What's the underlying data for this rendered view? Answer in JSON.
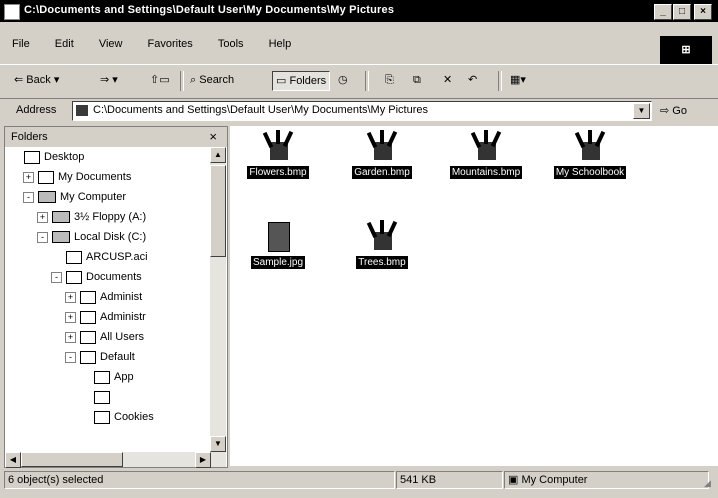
{
  "window": {
    "title": "C:\\Documents and Settings\\Default User\\My Documents\\My Pictures",
    "controls": [
      "_",
      "□",
      "×"
    ]
  },
  "menu": [
    "File",
    "Edit",
    "View",
    "Favorites",
    "Tools",
    "Help"
  ],
  "toolbar": {
    "back": "Back",
    "search": "Search",
    "folders": "Folders"
  },
  "address": {
    "label": "Address",
    "value": "C:\\Documents and Settings\\Default User\\My Documents\\My Pictures",
    "go": "Go"
  },
  "folders_pane": {
    "title": "Folders",
    "close": "×",
    "tree": [
      {
        "label": "Desktop",
        "depth": 0,
        "expander": "",
        "kind": "desktop"
      },
      {
        "label": "My Documents",
        "depth": 1,
        "expander": "+",
        "kind": "folder"
      },
      {
        "label": "My Computer",
        "depth": 1,
        "expander": "-",
        "kind": "computer"
      },
      {
        "label": "3½ Floppy (A:)",
        "depth": 2,
        "expander": "+",
        "kind": "drive"
      },
      {
        "label": "Local Disk (C:)",
        "depth": 2,
        "expander": "-",
        "kind": "drive"
      },
      {
        "label": "ARCUSP.aci",
        "depth": 3,
        "expander": "",
        "kind": "folder"
      },
      {
        "label": "Documents",
        "depth": 3,
        "expander": "-",
        "kind": "folder"
      },
      {
        "label": "Administ",
        "depth": 4,
        "expander": "+",
        "kind": "folder"
      },
      {
        "label": "Administr",
        "depth": 4,
        "expander": "+",
        "kind": "folder"
      },
      {
        "label": "All Users",
        "depth": 4,
        "expander": "+",
        "kind": "folder"
      },
      {
        "label": "Default",
        "depth": 4,
        "expander": "-",
        "kind": "folder"
      },
      {
        "label": "App",
        "depth": 5,
        "expander": "",
        "kind": "folder"
      },
      {
        "label": "",
        "depth": 5,
        "expander": "",
        "kind": "folder"
      },
      {
        "label": "Cookies",
        "depth": 5,
        "expander": "",
        "kind": "folder"
      }
    ]
  },
  "files": [
    {
      "label": "Flowers.bmp",
      "kind": "image"
    },
    {
      "label": "Garden.bmp",
      "kind": "image"
    },
    {
      "label": "Mountains.bmp",
      "kind": "image"
    },
    {
      "label": "My Schoolbook",
      "kind": "image"
    },
    {
      "label": "Sample.jpg",
      "kind": "doc"
    },
    {
      "label": "Trees.bmp",
      "kind": "image"
    }
  ],
  "status": {
    "selection": "6 object(s) selected",
    "size": "541 KB",
    "zone": "My Computer"
  }
}
